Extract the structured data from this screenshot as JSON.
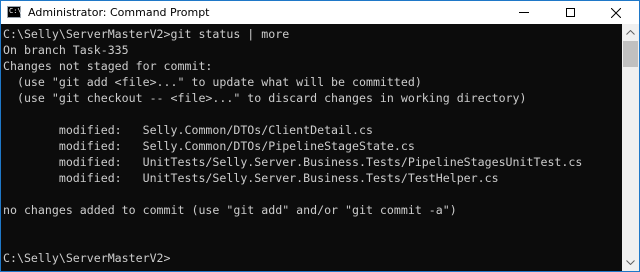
{
  "window": {
    "title": "Administrator: Command Prompt",
    "icon_label": "C:\\",
    "icons": {
      "app": "cmd-icon",
      "minimize": "minimize-icon",
      "maximize": "maximize-icon",
      "close": "close-icon"
    }
  },
  "console": {
    "lines": [
      "C:\\Selly\\ServerMasterV2>git status | more",
      "On branch Task-335",
      "Changes not staged for commit:",
      "  (use \"git add <file>...\" to update what will be committed)",
      "  (use \"git checkout -- <file>...\" to discard changes in working directory)",
      "",
      "        modified:   Selly.Common/DTOs/ClientDetail.cs",
      "        modified:   Selly.Common/DTOs/PipelineStageState.cs",
      "        modified:   UnitTests/Selly.Server.Business.Tests/PipelineStagesUnitTest.cs",
      "        modified:   UnitTests/Selly.Server.Business.Tests/TestHelper.cs",
      "",
      "no changes added to commit (use \"git add\" and/or \"git commit -a\")",
      "",
      "",
      "C:\\Selly\\ServerMasterV2>"
    ],
    "colors": {
      "background": "#0c0c0c",
      "text": "#cccccc"
    }
  },
  "scrollbar": {
    "icons": {
      "up": "scroll-up-arrow-icon",
      "down": "scroll-down-arrow-icon"
    }
  }
}
